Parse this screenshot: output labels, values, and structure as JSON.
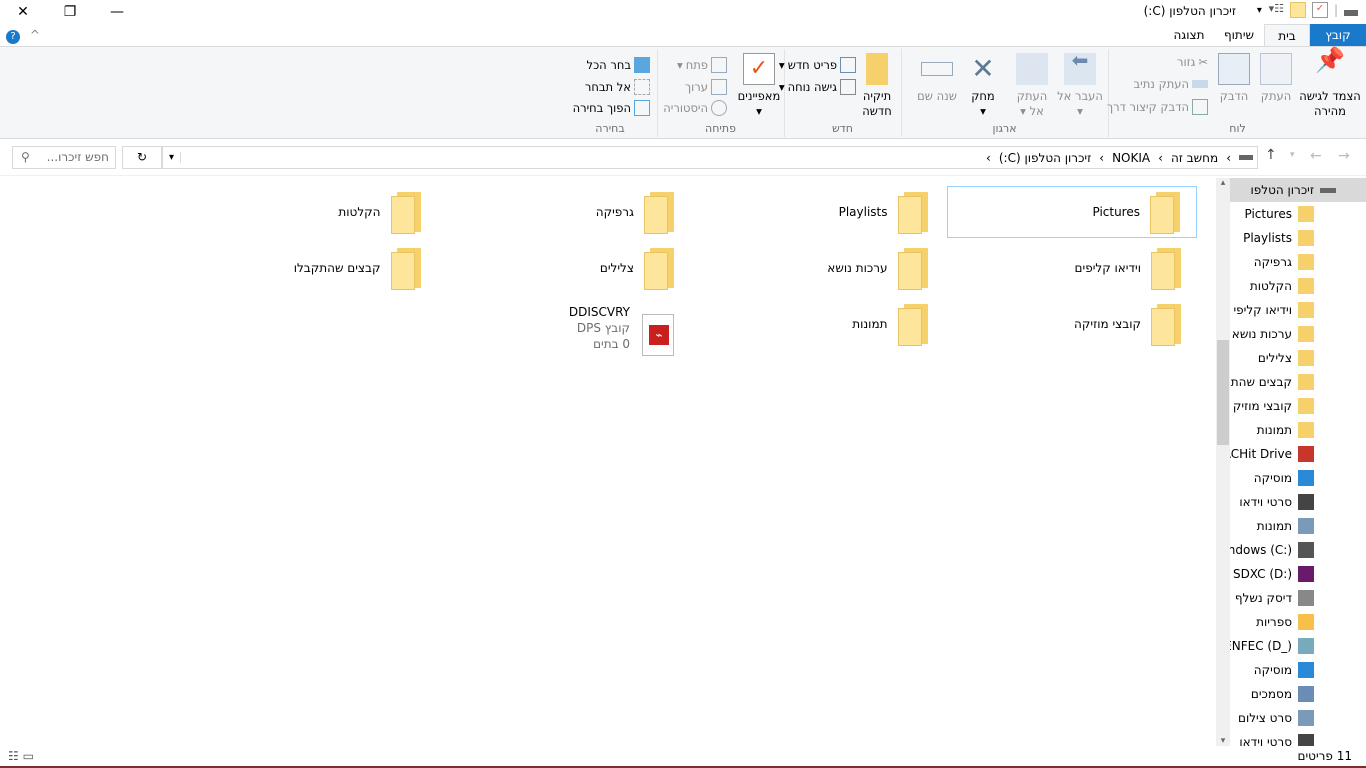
{
  "window": {
    "title": "זיכרון הטלפון (C:)"
  },
  "tabs": [
    {
      "label": "קובץ"
    },
    {
      "label": "בית"
    },
    {
      "label": "שיתוף"
    },
    {
      "label": "תצוגה"
    }
  ],
  "ribbon": {
    "clipboard": {
      "label": "לוח",
      "pin": "הצמד לגישה מהירה",
      "copy": "העתק",
      "paste": "הדבק",
      "cut": "גזור",
      "copy_path": "העתק נתיב",
      "paste_shortcut": "הדבק קיצור דרך"
    },
    "organize": {
      "label": "ארגון",
      "move_to": "העבר אל",
      "copy_to": "העתק אל",
      "delete": "מחק",
      "rename": "שנה שם"
    },
    "new": {
      "label": "חדש",
      "new_folder": "תיקיה חדשה",
      "new_item": "פריט חדש",
      "easy_access": "גישה נוחה"
    },
    "open": {
      "label": "פתיחה",
      "properties": "מאפיינים",
      "open": "פתח",
      "edit": "ערוך",
      "history": "היסטוריה"
    },
    "select": {
      "label": "בחירה",
      "select_all": "בחר הכל",
      "select_none": "אל תבחר",
      "invert": "הפוך בחירה"
    }
  },
  "address": {
    "crumbs": [
      "מחשב זה",
      "NOKIA",
      "זיכרון הטלפון (C:)"
    ],
    "search_placeholder": "חפש זיכרו..."
  },
  "nav": [
    {
      "label": "זיכרון הטלפו",
      "icon": "drive-icon",
      "top": true
    },
    {
      "label": "Pictures",
      "icon": "folder-icon"
    },
    {
      "label": "Playlists",
      "icon": "folder-icon"
    },
    {
      "label": "גרפיקה",
      "icon": "folder-icon"
    },
    {
      "label": "הקלטות",
      "icon": "folder-icon"
    },
    {
      "label": "וידיאו קליפי",
      "icon": "folder-icon"
    },
    {
      "label": "ערכות נושא",
      "icon": "folder-icon"
    },
    {
      "label": "צלילים",
      "icon": "folder-icon"
    },
    {
      "label": "קבצים שהת",
      "icon": "folder-icon"
    },
    {
      "label": "קובצי מוזיק",
      "icon": "folder-icon"
    },
    {
      "label": "תמונות",
      "icon": "folder-icon"
    },
    {
      "label": "REACHit Drive",
      "icon": "reachit-icon"
    },
    {
      "label": "מוסיקה",
      "icon": "music-icon"
    },
    {
      "label": "סרטי וידאו",
      "icon": "video-icon"
    },
    {
      "label": "תמונות",
      "icon": "pictures-icon"
    },
    {
      "label": "Windows (C:)",
      "icon": "windows-drive-icon"
    },
    {
      "label": "SDXC (D:)",
      "icon": "sd-card-icon"
    },
    {
      "label": "דיסק נשלף (E:",
      "icon": "usb-drive-icon"
    },
    {
      "label": "ספריות",
      "icon": "libraries-icon"
    },
    {
      "label": "CHENFEC (D_)",
      "icon": "network-drive-icon"
    },
    {
      "label": "מוסיקה",
      "icon": "music-icon"
    },
    {
      "label": "מסמכים",
      "icon": "documents-icon"
    },
    {
      "label": "סרט צילום",
      "icon": "pictures-icon"
    },
    {
      "label": "סרטי וידאו",
      "icon": "video-icon"
    }
  ],
  "items": [
    {
      "name": "Pictures",
      "type": "folder",
      "selected": true
    },
    {
      "name": "Playlists",
      "type": "folder"
    },
    {
      "name": "גרפיקה",
      "type": "folder"
    },
    {
      "name": "הקלטות",
      "type": "folder"
    },
    {
      "name": "וידיאו קליפים",
      "type": "folder"
    },
    {
      "name": "ערכות נושא",
      "type": "folder"
    },
    {
      "name": "צלילים",
      "type": "folder"
    },
    {
      "name": "קבצים שהתקבלו",
      "type": "folder"
    },
    {
      "name": "קובצי מוזיקה",
      "type": "folder"
    },
    {
      "name": "תמונות",
      "type": "folder"
    },
    {
      "name": "DDISCVRY",
      "type": "file",
      "kind": "קובץ DPS",
      "size": "0 בתים"
    }
  ],
  "status": {
    "count": "11 פריטים"
  },
  "colors": {
    "accent": "#1979ca",
    "folder": "#f6d06b",
    "selection": "#99d1ff"
  }
}
